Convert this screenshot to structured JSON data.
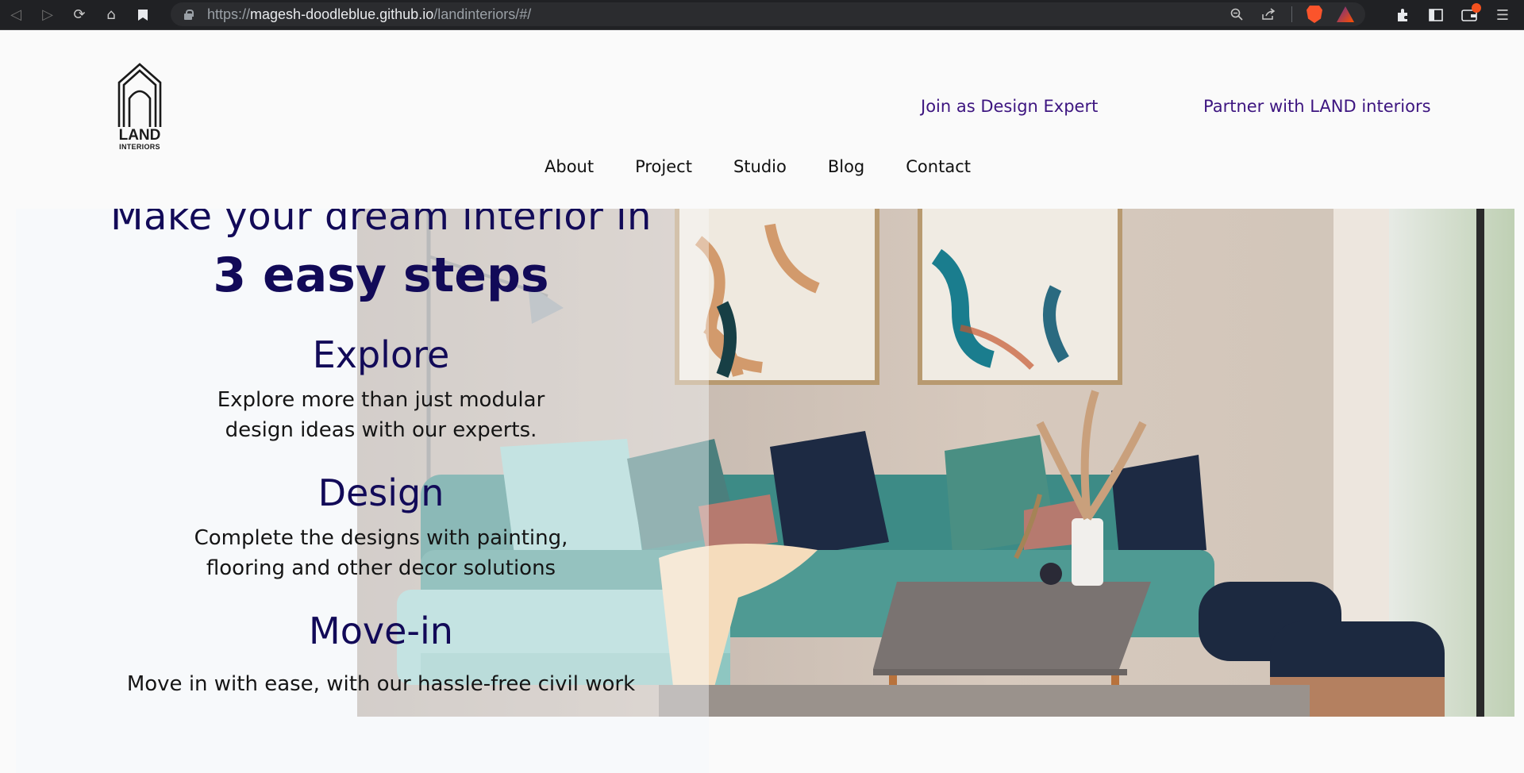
{
  "browser": {
    "url_prefix": "https://",
    "url_host": "magesh-doodleblue.github.io",
    "url_path": "/landinteriors/#/"
  },
  "logo": {
    "name": "LAND",
    "sub": "INTERIORS"
  },
  "header": {
    "links": [
      "Join as Design Expert",
      "Partner with LAND interiors"
    ],
    "nav": [
      "About",
      "Project",
      "Studio",
      "Blog",
      "Contact"
    ]
  },
  "hero": {
    "line1": "Make your dream interior in",
    "line2": "3 easy steps",
    "steps": [
      {
        "title": "Explore",
        "desc": "Explore more than just modular design ideas with our experts."
      },
      {
        "title": "Design",
        "desc": "Complete the designs with painting, flooring and other decor solutions"
      },
      {
        "title": "Move-in",
        "desc": "Move in with ease, with our hassle-free civil work"
      }
    ]
  },
  "colors": {
    "accent": "#3d1580",
    "heading": "#120a58"
  }
}
